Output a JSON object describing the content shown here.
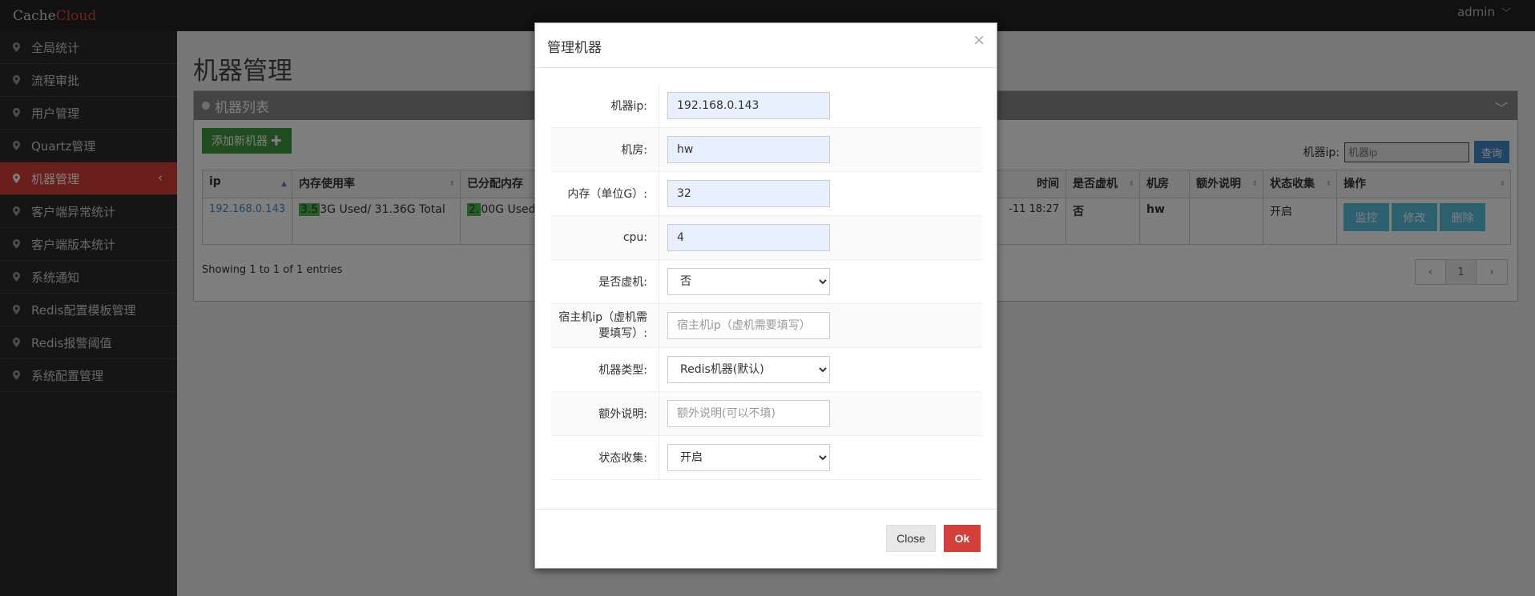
{
  "brand": {
    "part1": "Cache",
    "part2": "Cloud"
  },
  "user": {
    "name": "admin"
  },
  "sidebar": {
    "items": [
      {
        "label": "全局统计"
      },
      {
        "label": "流程审批"
      },
      {
        "label": "用户管理"
      },
      {
        "label": "Quartz管理"
      },
      {
        "label": "机器管理",
        "active": true
      },
      {
        "label": "客户端异常统计"
      },
      {
        "label": "客户端版本统计"
      },
      {
        "label": "系统通知"
      },
      {
        "label": "Redis配置模板管理"
      },
      {
        "label": "Redis报警阈值"
      },
      {
        "label": "系统配置管理"
      }
    ]
  },
  "main": {
    "title": "机器管理",
    "panel_title": "机器列表",
    "add_button": "添加新机器 ✚",
    "filter_label": "机器ip:",
    "filter_placeholder": "机器ip",
    "query_button": "查询",
    "table": {
      "headers": [
        "ip",
        "内存使用率",
        "已分配内存",
        "时间",
        "是否虚机",
        "机房",
        "额外说明",
        "状态收集",
        "操作"
      ],
      "row": {
        "ip": "192.168.0.143",
        "mem_used_bar": "3.5",
        "mem_used_rest": "3G  Used/ 31.36G  Total",
        "alloc_bar": "2.",
        "alloc_rest": "00G  Used/",
        "time": "-11 18:27",
        "is_vm": "否",
        "room": "hw",
        "extra": "",
        "collect": "开启",
        "actions": [
          "监控",
          "修改",
          "删除"
        ]
      }
    },
    "showing": "Showing 1 to 1 of 1 entries",
    "pager": {
      "prev": "‹",
      "page": "1",
      "next": "›"
    }
  },
  "modal": {
    "title": "管理机器",
    "close_x": "×",
    "fields": {
      "ip": {
        "label": "机器ip:",
        "value": "192.168.0.143"
      },
      "room": {
        "label": "机房:",
        "value": "hw"
      },
      "mem": {
        "label": "内存（单位G）:",
        "value": "32"
      },
      "cpu": {
        "label": "cpu:",
        "value": "4"
      },
      "vm": {
        "label": "是否虚机:",
        "value": "否"
      },
      "host_ip": {
        "label": "宿主机ip（虚机需要填写）:",
        "placeholder": "宿主机ip（虚机需要填写）"
      },
      "type": {
        "label": "机器类型:",
        "value": "Redis机器(默认)"
      },
      "extra": {
        "label": "额外说明:",
        "placeholder": "额外说明(可以不填)"
      },
      "collect": {
        "label": "状态收集:",
        "value": "开启"
      }
    },
    "close_button": "Close",
    "ok_button": "Ok"
  },
  "colors": {
    "accent_red": "#d43f3a",
    "green": "#3e9b3e",
    "blue": "#428bca",
    "cyan": "#5bc0de"
  }
}
